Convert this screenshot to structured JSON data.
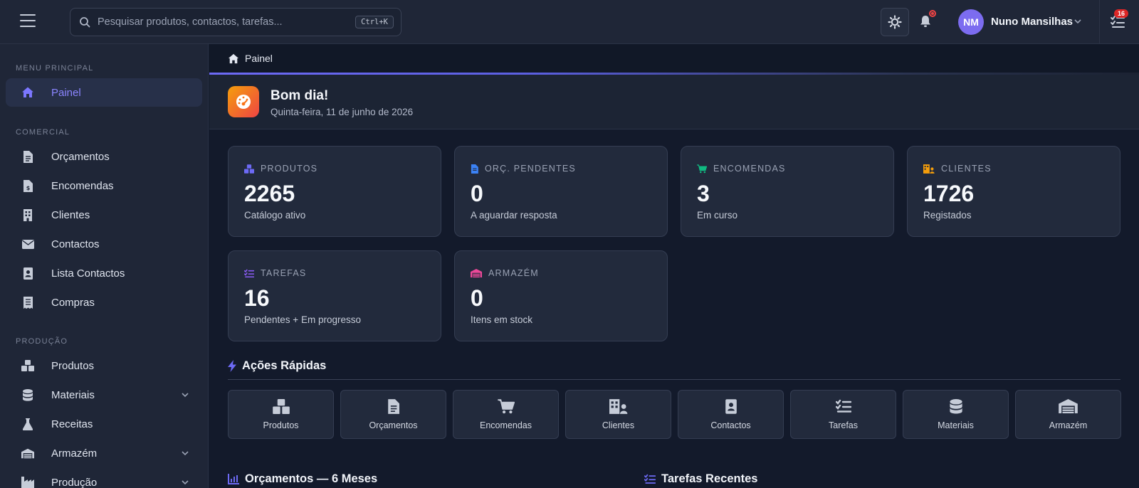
{
  "topbar": {
    "search_placeholder": "Pesquisar produtos, contactos, tarefas...",
    "search_shortcut": "Ctrl+K",
    "user_initials": "NM",
    "user_name": "Nuno Mansilhas",
    "tasks_badge": "16"
  },
  "sidebar": {
    "sections": [
      {
        "title": "MENU PRINCIPAL",
        "items": [
          {
            "label": "Painel",
            "icon": "home-icon",
            "active": true
          }
        ]
      },
      {
        "title": "COMERCIAL",
        "items": [
          {
            "label": "Orçamentos",
            "icon": "document-icon"
          },
          {
            "label": "Encomendas",
            "icon": "invoice-icon"
          },
          {
            "label": "Clientes",
            "icon": "building-icon"
          },
          {
            "label": "Contactos",
            "icon": "envelope-icon"
          },
          {
            "label": "Lista Contactos",
            "icon": "address-book-icon"
          },
          {
            "label": "Compras",
            "icon": "receipt-icon"
          }
        ]
      },
      {
        "title": "PRODUÇÃO",
        "items": [
          {
            "label": "Produtos",
            "icon": "boxes-icon"
          },
          {
            "label": "Materiais",
            "icon": "database-icon",
            "expandable": true
          },
          {
            "label": "Receitas",
            "icon": "flask-icon"
          },
          {
            "label": "Armazém",
            "icon": "warehouse-icon",
            "expandable": true
          },
          {
            "label": "Produção",
            "icon": "industry-icon",
            "expandable": true
          }
        ]
      }
    ]
  },
  "breadcrumb": {
    "label": "Painel"
  },
  "greeting": {
    "title": "Bom dia!",
    "date": "Quinta-feira, 11 de junho de 2026"
  },
  "stats": [
    {
      "label": "PRODUTOS",
      "value": "2265",
      "sub": "Catálogo ativo",
      "icon": "boxes-icon",
      "color": "#6d6af5"
    },
    {
      "label": "ORÇ. PENDENTES",
      "value": "0",
      "sub": "A aguardar resposta",
      "icon": "document-icon",
      "color": "#3b82f6"
    },
    {
      "label": "ENCOMENDAS",
      "value": "3",
      "sub": "Em curso",
      "icon": "cart-icon",
      "color": "#10b981"
    },
    {
      "label": "CLIENTES",
      "value": "1726",
      "sub": "Registados",
      "icon": "building-user-icon",
      "color": "#f59e0b"
    },
    {
      "label": "TAREFAS",
      "value": "16",
      "sub": "Pendentes + Em progresso",
      "icon": "list-check-icon",
      "color": "#8b5cf6"
    },
    {
      "label": "ARMAZÉM",
      "value": "0",
      "sub": "Itens em stock",
      "icon": "warehouse-icon",
      "color": "#ec4899"
    }
  ],
  "quick_actions": {
    "title": "Ações Rápidas",
    "items": [
      {
        "label": "Produtos",
        "icon": "boxes-icon"
      },
      {
        "label": "Orçamentos",
        "icon": "document-icon"
      },
      {
        "label": "Encomendas",
        "icon": "cart-icon"
      },
      {
        "label": "Clientes",
        "icon": "building-user-icon"
      },
      {
        "label": "Contactos",
        "icon": "address-book-icon"
      },
      {
        "label": "Tarefas",
        "icon": "list-check-icon"
      },
      {
        "label": "Materiais",
        "icon": "database-icon"
      },
      {
        "label": "Armazém",
        "icon": "warehouse-icon"
      }
    ]
  },
  "sections": {
    "budgets_title": "Orçamentos — 6 Meses",
    "tasks_title": "Tarefas Recentes"
  },
  "colors": {
    "accent": "#6d6af5",
    "background": "#131a2b",
    "panel": "#1f2637",
    "card": "#222a3c"
  }
}
